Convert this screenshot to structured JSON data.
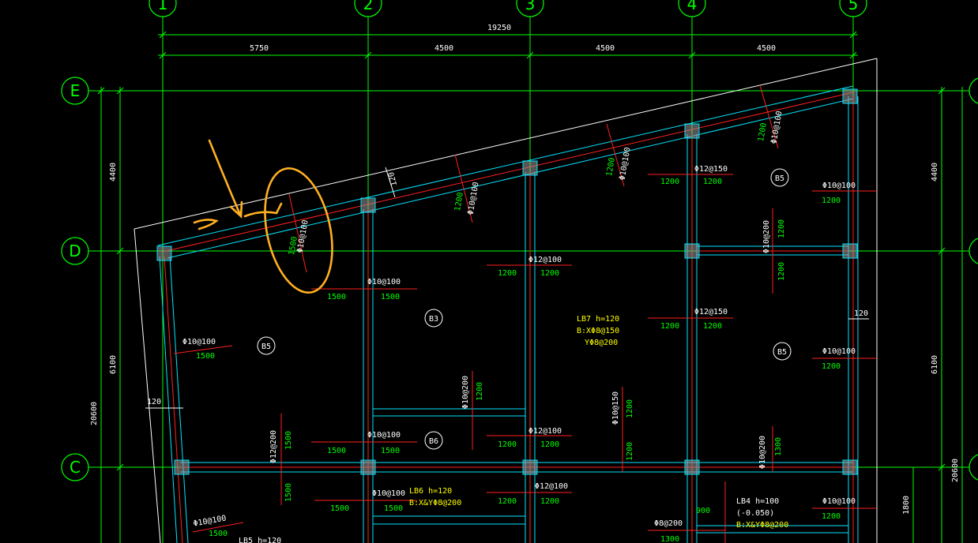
{
  "colors": {
    "background": "#000000",
    "grid": "#00ff00",
    "beam": "#00e5ff",
    "rebar": "#ff2020",
    "text_white": "#ffffff",
    "text_yellow": "#ffff00",
    "text_green": "#00ff00",
    "annotation": "#ffb020",
    "column": "#9a9a9a"
  },
  "axes": {
    "vertical": [
      "1",
      "2",
      "3",
      "4",
      "5"
    ],
    "horizontal": [
      "E",
      "D",
      "C"
    ]
  },
  "dimensions": {
    "total_top": "19250",
    "spans_top": [
      "5750",
      "4500",
      "4500",
      "4500"
    ],
    "left_spans": [
      "4400",
      "6100"
    ],
    "left_total": "20600",
    "right_spans": [
      "4400",
      "6100"
    ],
    "right_total": "20600",
    "right_lower": "1800",
    "thickness_a": "120",
    "thickness_b": "120",
    "thickness_c": "120"
  },
  "slabs": {
    "b5_top": "B5",
    "b5_left": "B5",
    "b3": "B3",
    "b5_right": "B5",
    "b6": "B6"
  },
  "notes": {
    "lb7_line1": "LB7 h=120",
    "lb7_line2": "B:XΦ8@150",
    "lb7_line3": "YΦ8@200",
    "lb6_line1": "LB6 h=120",
    "lb6_line2": "B:X&YΦ8@200",
    "lb4_line1": "LB4 h=100",
    "lb4_line2": "(-0.050)",
    "lb4_line3": "B:X&YΦ8@200",
    "lb5_line1": "LB5 h=120"
  },
  "rebars": {
    "spec_10_100": "Φ10@100",
    "spec_12_100": "Φ12@100",
    "spec_12_150": "Φ12@150",
    "spec_10_200": "Φ10@200",
    "spec_12_200": "Φ12@200",
    "spec_8_200": "Φ8@200",
    "spec_10_150": "Φ10@150",
    "len_1500": "1500",
    "len_1200": "1200",
    "len_1300": "1300",
    "len_900": "900"
  },
  "annotation": {
    "arrow": "arrow-icon",
    "ellipse": "ellipse-highlight"
  }
}
